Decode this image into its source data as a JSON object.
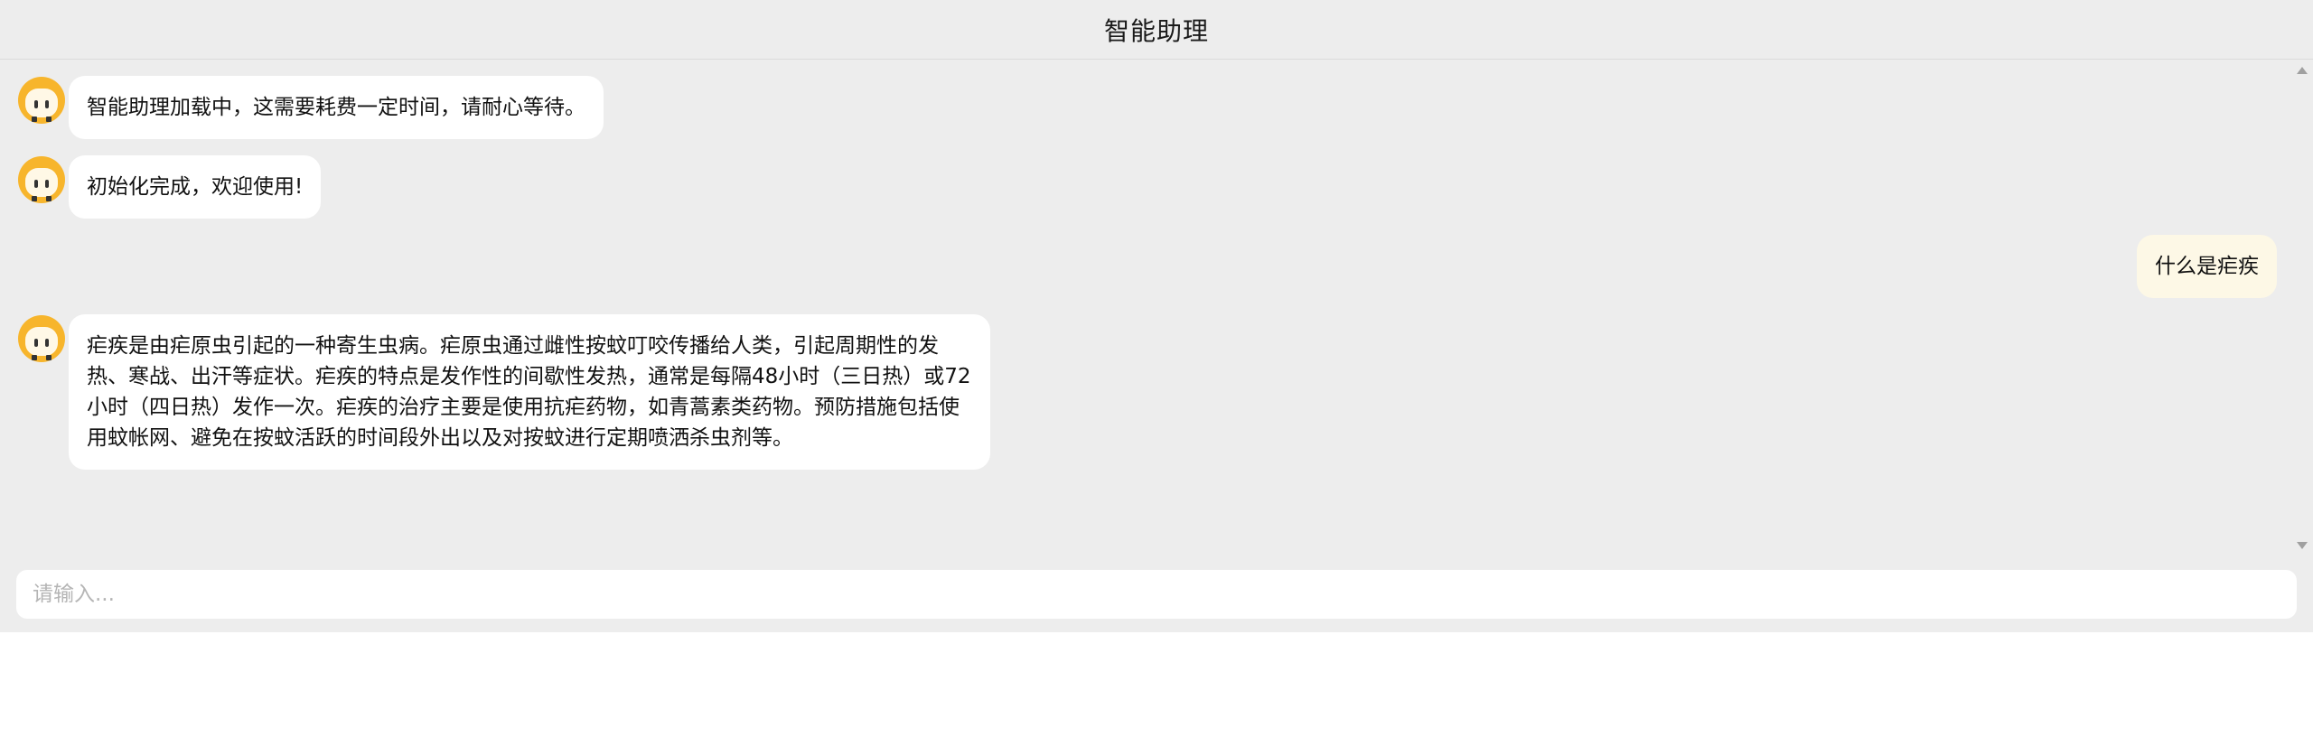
{
  "header": {
    "title": "智能助理"
  },
  "messages": [
    {
      "role": "assistant",
      "text": "智能助理加载中，这需要耗费一定时间，请耐心等待。"
    },
    {
      "role": "assistant",
      "text": "初始化完成，欢迎使用!"
    },
    {
      "role": "user",
      "text": "什么是疟疾"
    },
    {
      "role": "assistant",
      "text": "疟疾是由疟原虫引起的一种寄生虫病。疟原虫通过雌性按蚊叮咬传播给人类，引起周期性的发热、寒战、出汗等症状。疟疾的特点是发作性的间歇性发热，通常是每隔48小时（三日热）或72小时（四日热）发作一次。疟疾的治疗主要是使用抗疟药物，如青蒿素类药物。预防措施包括使用蚊帐网、避免在按蚊活跃的时间段外出以及对按蚊进行定期喷洒杀虫剂等。"
    }
  ],
  "input": {
    "placeholder": "请输入...",
    "value": ""
  },
  "colors": {
    "background": "#ededed",
    "assistant_bubble": "#ffffff",
    "user_bubble": "#fdf8e6",
    "avatar": "#f7b52c"
  },
  "icons": {
    "assistant_avatar": "assistant-avatar-icon",
    "scroll_up": "scroll-up-arrow",
    "scroll_down": "scroll-down-arrow"
  }
}
